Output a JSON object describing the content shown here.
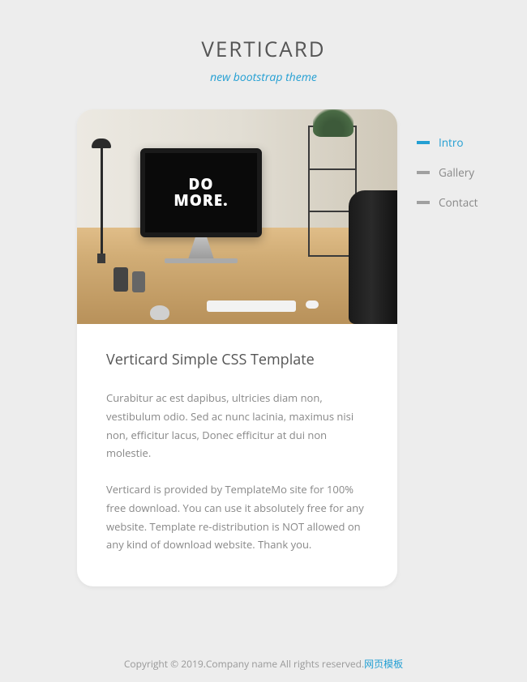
{
  "header": {
    "title": "VERTICARD",
    "subtitle": "new bootstrap theme"
  },
  "hero": {
    "monitor_text_line1": "DO",
    "monitor_text_line2": "MORE."
  },
  "card": {
    "title": "Verticard Simple CSS Template",
    "paragraph1": "Curabitur ac est dapibus, ultricies diam non, vestibulum odio. Sed ac nunc lacinia, maximus nisi non, efficitur lacus, Donec efficitur at dui non molestie.",
    "paragraph2": "Verticard is provided by TemplateMo site for 100% free download. You can use it absolutely free for any website. Template re-distribution is NOT allowed on any kind of download website. Thank you."
  },
  "nav": {
    "items": [
      {
        "label": "Intro",
        "active": true
      },
      {
        "label": "Gallery",
        "active": false
      },
      {
        "label": "Contact",
        "active": false
      }
    ]
  },
  "footer": {
    "copyright": "Copyright © 2019.Company name All rights reserved.",
    "link_text": "网页模板"
  }
}
